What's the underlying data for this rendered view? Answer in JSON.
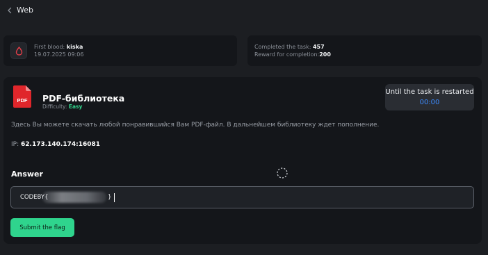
{
  "topbar": {
    "title": "Web"
  },
  "first_blood": {
    "label": "First blood:",
    "user": "kiska",
    "date": "19.07.2025 09:06",
    "icon": "blood-drop-icon"
  },
  "stats": {
    "completed_label": "Completed the task:",
    "completed_value": "457",
    "reward_label": "Reward for completion:",
    "reward_value": "200"
  },
  "task": {
    "icon": "pdf-icon",
    "icon_text": "PDF",
    "title": "PDF-библиотека",
    "difficulty_label": "Difficulty:",
    "difficulty_value": "Easy",
    "description": "Здесь Вы можете скачать любой понравившийся Вам PDF-файл. В дальнейшем библиотеку ждет пополнение.",
    "ip_label": "IP:",
    "ip_value": "62.173.140.174:16081"
  },
  "timer": {
    "label": "Until the task is restarted",
    "value": "00:00"
  },
  "answer": {
    "label": "Answer",
    "value_prefix": "CODEBY{",
    "value_suffix": "}"
  },
  "submit": {
    "label": "Submit the flag"
  },
  "colors": {
    "background": "#1c1e22",
    "card": "#14161a",
    "accent_green": "#2fd48d",
    "timer_blue": "#3d8bff",
    "pdf_red": "#e0262b"
  }
}
